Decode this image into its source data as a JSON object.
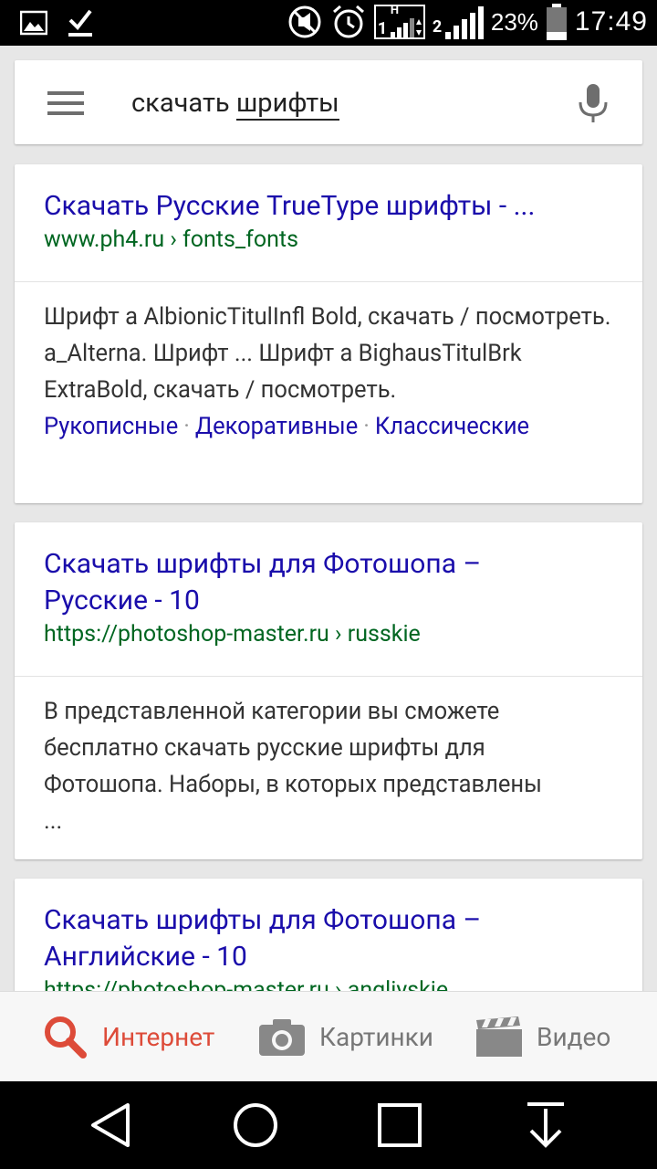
{
  "status_bar": {
    "battery_percent": "23%",
    "time": "17:49",
    "sim1_label": "1",
    "sim2_label": "2",
    "sim1_network": "H"
  },
  "search": {
    "query_plain": "скачать ",
    "query_underlined": "шрифты"
  },
  "results": [
    {
      "title": "Скачать Русские TrueType шрифты - ...",
      "url": "www.ph4.ru › fonts_fonts",
      "snippet": "Шрифт a AlbionicTitulInfl Bold, скачать / посмотреть. a_Alterna. Шрифт ... Шрифт a BighausTitulBrk ExtraBold, скачать / посмотреть.",
      "sitelinks": [
        "Рукописные",
        "Декоративные",
        "Классические"
      ]
    },
    {
      "title": "Скачать шрифты для Фотошопа – Русские - 10",
      "url": "https://photoshop-master.ru › russkie",
      "snippet": "В представленной категории вы сможете бесплатно скачать русские шрифты для Фотошопа. Наборы, в которых представлены ..."
    },
    {
      "title": "Скачать шрифты для Фотошопа – Английские - 10",
      "url": "https://photoshop-master.ru › angliyskie"
    }
  ],
  "tabs": [
    {
      "label": "Интернет",
      "icon": "search-icon",
      "active": true
    },
    {
      "label": "Картинки",
      "icon": "camera-icon",
      "active": false
    },
    {
      "label": "Видео",
      "icon": "clapperboard-icon",
      "active": false
    }
  ],
  "colors": {
    "title_link": "#1a0dab",
    "url_green": "#006621",
    "active_tab": "#dd4b39"
  }
}
